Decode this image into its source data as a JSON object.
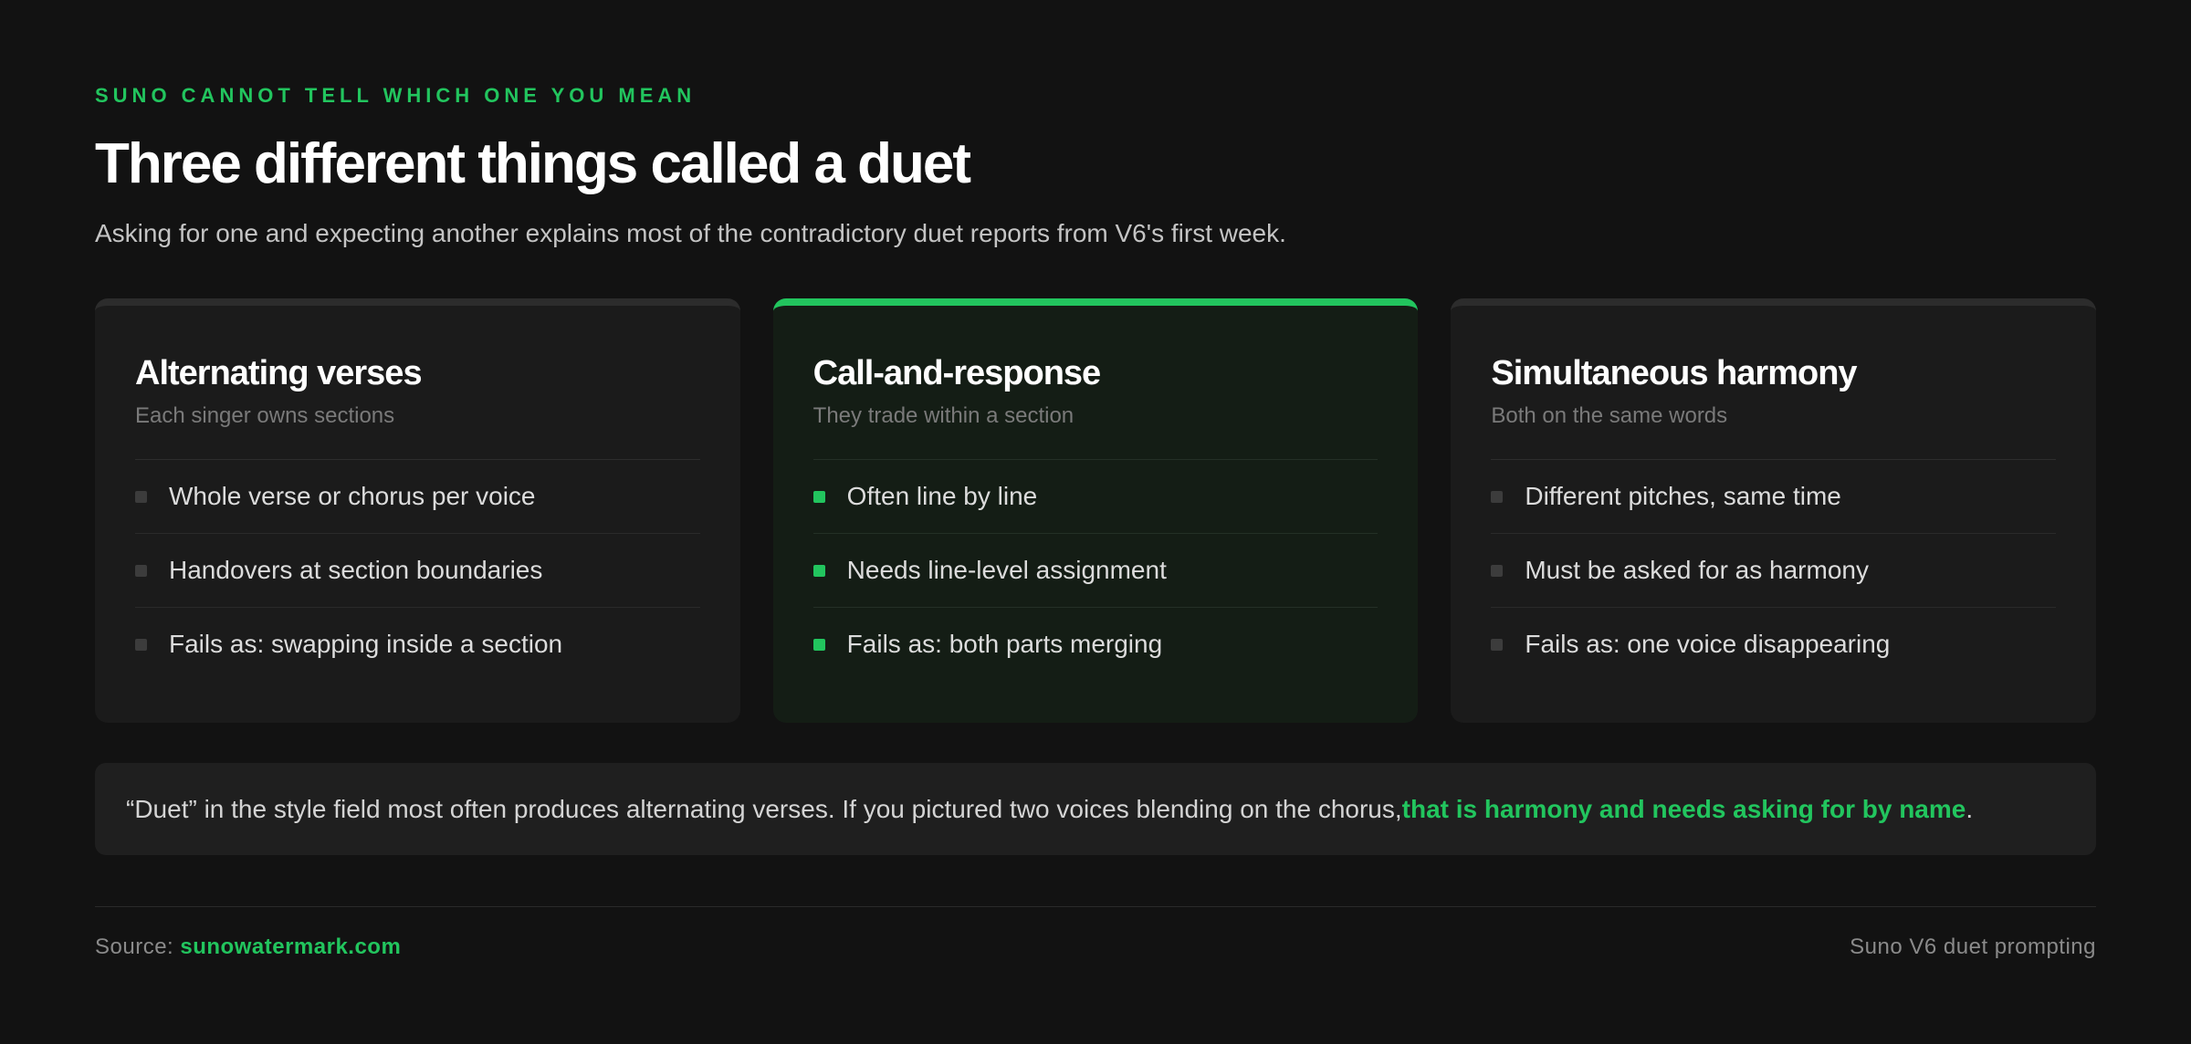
{
  "header": {
    "eyebrow": "SUNO CANNOT TELL WHICH ONE YOU MEAN",
    "title": "Three different things called a duet",
    "subtitle": "Asking for one and expecting another explains most of the contradictory duet reports from V6's first week."
  },
  "cards": [
    {
      "title": "Alternating verses",
      "subtitle": "Each singer owns sections",
      "highlighted": false,
      "items": [
        "Whole verse or chorus per voice",
        "Handovers at section boundaries",
        "Fails as: swapping inside a section"
      ]
    },
    {
      "title": "Call-and-response",
      "subtitle": "They trade within a section",
      "highlighted": true,
      "items": [
        "Often line by line",
        "Needs line-level assignment",
        "Fails as: both parts merging"
      ]
    },
    {
      "title": "Simultaneous harmony",
      "subtitle": "Both on the same words",
      "highlighted": false,
      "items": [
        "Different pitches, same time",
        "Must be asked for as harmony",
        "Fails as: one voice disappearing"
      ]
    }
  ],
  "note": {
    "text": "“Duet” in the style field most often produces alternating verses. If you pictured two voices blending on the chorus, ",
    "emphasis": "that is harmony and needs asking for by name",
    "end": "."
  },
  "footer": {
    "source_label": "Source: ",
    "source_link": "sunowatermark.com",
    "right_text": "Suno V6 duet prompting"
  },
  "colors": {
    "accent": "#22c55e",
    "background": "#121212",
    "card": "#1b1b1b",
    "card_highlight": "#141d15"
  }
}
